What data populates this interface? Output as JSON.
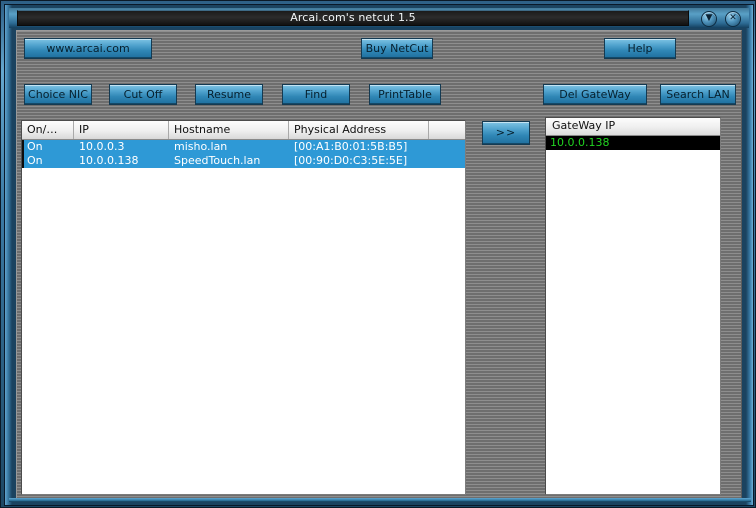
{
  "window": {
    "title": "Arcai.com's netcut 1.5",
    "minimize_glyph": "▼",
    "close_glyph": "✕",
    "accent_color": "#4e94bd",
    "button_face_color": "#4fa2cd",
    "selection_color": "#2e99d6",
    "gateway_text_color": "#21d421"
  },
  "toolbar_top": {
    "site_button": "www.arcai.com",
    "buy_button": "Buy NetCut",
    "help_button": "Help"
  },
  "toolbar_main": {
    "choice_nic": "Choice NIC",
    "cut_off": "Cut Off",
    "resume": "Resume",
    "find": "Find",
    "print_table": "PrintTable",
    "del_gateway": "Del GateWay",
    "search_lan": "Search LAN"
  },
  "transfer": {
    "label": ">>"
  },
  "device_table": {
    "columns": [
      "On/…",
      "IP",
      "Hostname",
      "Physical Address",
      ""
    ],
    "rows": [
      {
        "on": "On",
        "ip": "10.0.0.3",
        "hostname": "misho.lan",
        "mac": "[00:A1:B0:01:5B:B5]",
        "selected": true
      },
      {
        "on": "On",
        "ip": "10.0.0.138",
        "hostname": "SpeedTouch.lan",
        "mac": "[00:90:D0:C3:5E:5E]",
        "selected": true
      }
    ]
  },
  "gateway_panel": {
    "header": "GateWay IP",
    "items": [
      "10.0.0.138"
    ]
  }
}
